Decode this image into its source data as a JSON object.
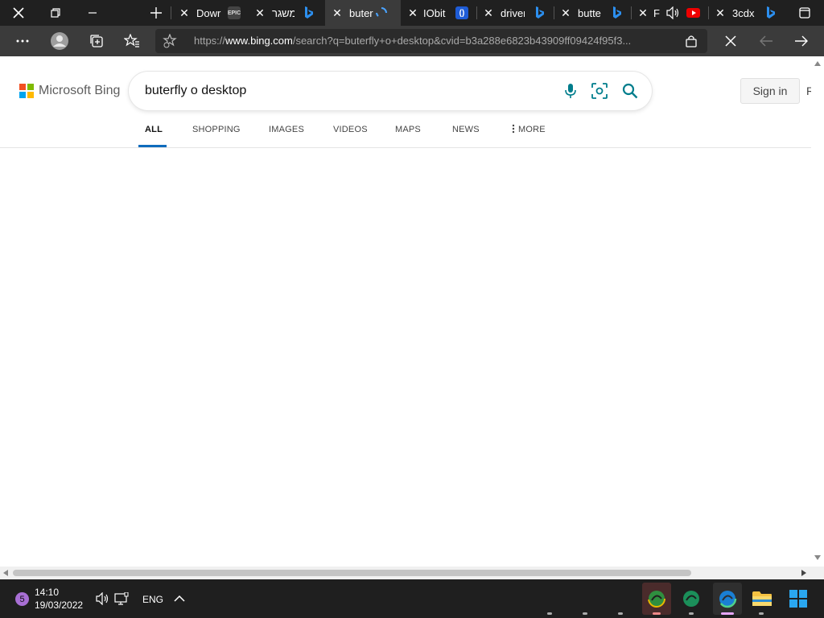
{
  "browser": {
    "tabs": [
      {
        "label": "Dowr",
        "favicon": "epic-icon"
      },
      {
        "label": "משגר",
        "favicon": "bing-icon"
      },
      {
        "label": "buter",
        "favicon": "loading-icon",
        "active": true
      },
      {
        "label": "IObit",
        "favicon": "iobit-icon"
      },
      {
        "label": "driver",
        "favicon": "bing-icon"
      },
      {
        "label": "butte",
        "favicon": "bing-icon"
      },
      {
        "label": "F",
        "favicon": "youtube-icon"
      },
      {
        "label": "3cdx",
        "favicon": "bing-icon"
      }
    ],
    "url": {
      "prefix": "https://",
      "domain": "www.bing.com",
      "rest": "/search?q=buterfly+o+desktop&cvid=b3a288e6823b43909ff09424f95f3..."
    }
  },
  "bing": {
    "logo_text": "Microsoft Bing",
    "query": "buterfly o desktop",
    "sign_in": "Sign in",
    "right_partial": "R",
    "nav": [
      {
        "label": "ALL",
        "active": true
      },
      {
        "label": "SHOPPING"
      },
      {
        "label": "IMAGES"
      },
      {
        "label": "VIDEOS"
      },
      {
        "label": "MAPS"
      },
      {
        "label": "NEWS"
      },
      {
        "label": "MORE"
      }
    ]
  },
  "taskbar": {
    "notification_count": "5",
    "time": "14:10",
    "date": "19/03/2022",
    "language": "ENG"
  },
  "colors": {
    "accent": "#0f6cbd",
    "bing_teal": "#007d8c",
    "logo_red": "#f25022",
    "logo_green": "#7fba00",
    "logo_blue": "#00a4ef",
    "logo_yellow": "#ffb900"
  }
}
